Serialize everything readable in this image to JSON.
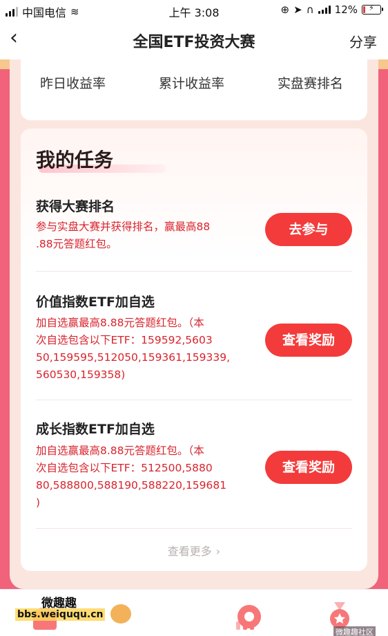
{
  "status_bar": {
    "carrier": "中国电信",
    "time": "上午 3:08",
    "battery": "12%",
    "battery_level": 0.12
  },
  "nav": {
    "title": "全国ETF投资大赛",
    "share": "分享"
  },
  "metrics": [
    "昨日收益率",
    "累计收益率",
    "实盘赛排名"
  ],
  "tasks_section": {
    "heading": "我的任务",
    "tasks": [
      {
        "title": "获得大赛排名",
        "desc_lines": [
          "参与实盘大赛并获得排名，赢最高88",
          ".88元答题红包。"
        ],
        "button": "去参与"
      },
      {
        "title": "价值指数ETF加自选",
        "desc_lines": [
          "加自选赢最高8.88元答题红包。（本",
          "次自选包含以下ETF：159592,5603",
          "50,159595,512050,159361,159339,",
          "560530,159358)"
        ],
        "button": "查看奖励"
      },
      {
        "title": "成长指数ETF加自选",
        "desc_lines": [
          "加自选赢最高8.88元答题红包。（本",
          "次自选包含以下ETF：512500,5880",
          "80,588800,588190,588220,159681",
          ")"
        ],
        "button": "查看奖励"
      }
    ],
    "more": "查看更多"
  },
  "watermark": {
    "top": "微趣趣",
    "bottom": "bbs.weiququ.cn",
    "corner": "微趣趣社区"
  }
}
